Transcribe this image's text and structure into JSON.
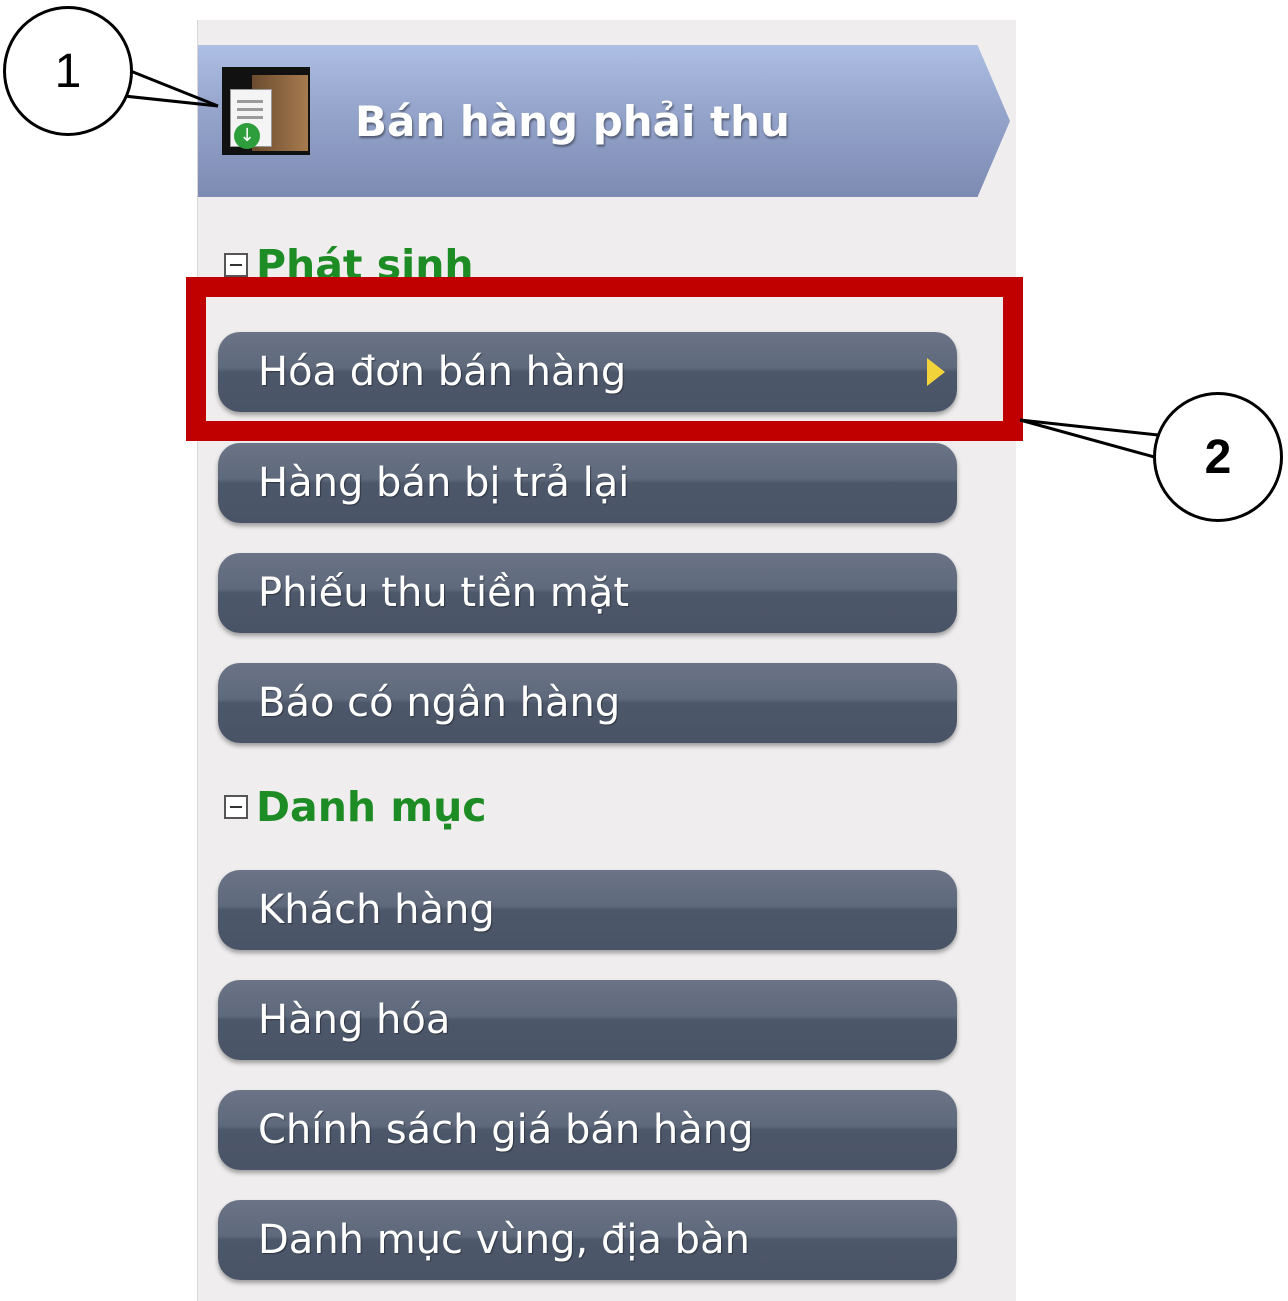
{
  "header": {
    "title": "Bán hàng phải thu",
    "icon": "sales-receivable-icon"
  },
  "sections": [
    {
      "label": "Phát sinh",
      "items": [
        {
          "label": "Hóa đơn bán hàng",
          "selected": true
        },
        {
          "label": "Hàng bán bị trả lại"
        },
        {
          "label": "Phiếu thu tiền mặt"
        },
        {
          "label": "Báo có ngân hàng"
        }
      ]
    },
    {
      "label": "Danh mục",
      "items": [
        {
          "label": "Khách hàng"
        },
        {
          "label": "Hàng hóa"
        },
        {
          "label": "Chính sách giá bán hàng"
        },
        {
          "label": "Danh mục vùng, địa bàn"
        }
      ]
    }
  ],
  "callouts": [
    "1",
    "2"
  ],
  "colors": {
    "section_label": "#1d8c24",
    "item_bg": "#5a6477",
    "highlight": "#c00000",
    "header_bg": "#96a6cd",
    "arrow": "#f2d43a"
  }
}
